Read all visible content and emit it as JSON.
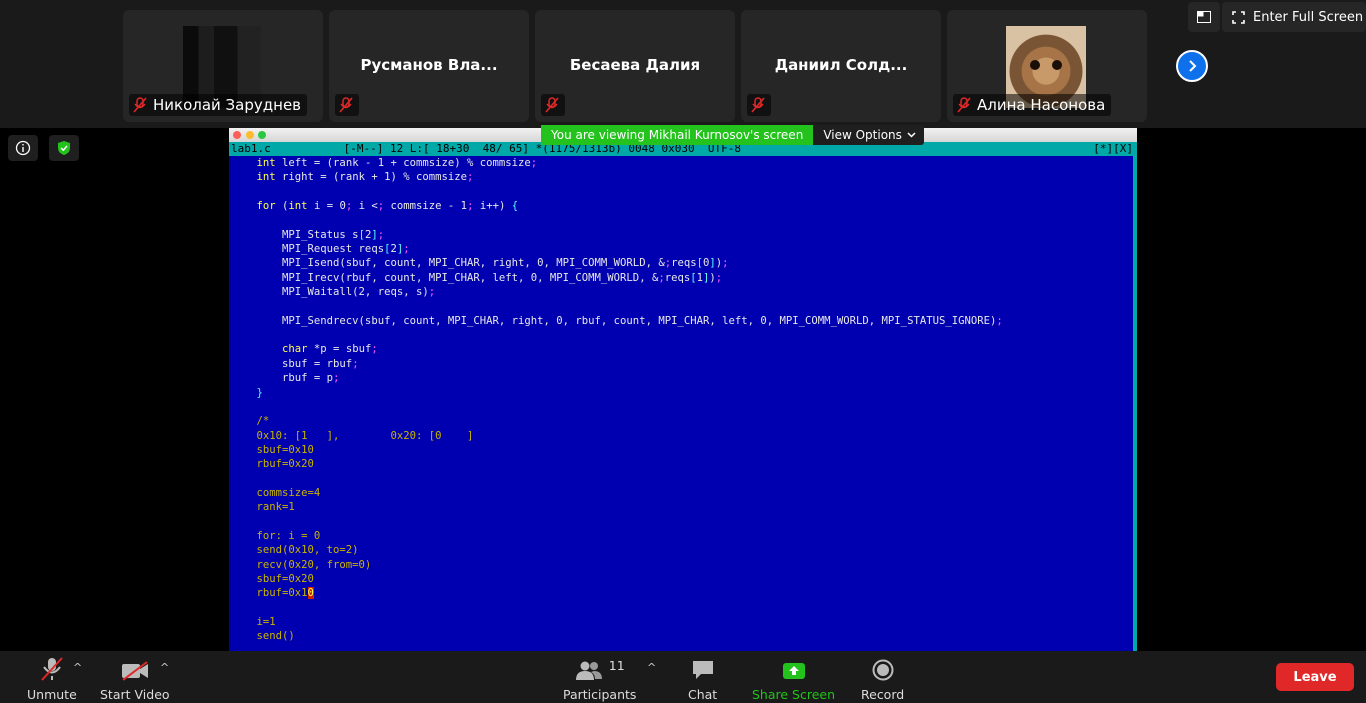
{
  "participants_strip": {
    "tiles": [
      {
        "name": "Николай Заруднев",
        "muted": true,
        "has_video": true
      },
      {
        "name": "Русманов Вла...",
        "muted": true,
        "has_video": false
      },
      {
        "name": "Бесаева Далия",
        "muted": true,
        "has_video": false
      },
      {
        "name": "Даниил Солд...",
        "muted": true,
        "has_video": false
      },
      {
        "name": "Алина Насонова",
        "muted": true,
        "has_video": true
      }
    ],
    "next_icon": "chevron-right-icon"
  },
  "top_controls": {
    "fullscreen_label": "Enter Full Screen"
  },
  "share_banner": {
    "text": "You are viewing Mikhail Kurnosov's screen",
    "options_label": "View Options"
  },
  "editor": {
    "status_left": "lab1.c           [-M--] 12 L:[ 18+30  48/ 65] *(1175/1313b) 0048 0x030  UTF-8",
    "status_right": "[*][X]",
    "lines": [
      "    int left = (rank - 1 + commsize) % commsize;",
      "    int right = (rank + 1) % commsize;",
      "",
      "    for (int i = 0; i < commsize - 1; i++) {",
      "",
      "        MPI_Status s[2];",
      "        MPI_Request reqs[2];",
      "        MPI_Isend(sbuf, count, MPI_CHAR, right, 0, MPI_COMM_WORLD, &reqs[0]);",
      "        MPI_Irecv(rbuf, count, MPI_CHAR, left, 0, MPI_COMM_WORLD, &reqs[1]);",
      "        MPI_Waitall(2, reqs, s);",
      "",
      "        MPI_Sendrecv(sbuf, count, MPI_CHAR, right, 0, rbuf, count, MPI_CHAR, left, 0, MPI_COMM_WORLD, MPI_STATUS_IGNORE);",
      "",
      "        char *p = sbuf;",
      "        sbuf = rbuf;",
      "        rbuf = p;",
      "    }",
      "",
      "    /*",
      "    0x10: [1   ],        0x20: [0    ]",
      "    sbuf=0x10",
      "    rbuf=0x20",
      "",
      "    commsize=4",
      "    rank=1",
      "",
      "    for: i = 0",
      "    send(0x10, to=2)",
      "    recv(0x20, from=0)",
      "    sbuf=0x20",
      "    rbuf=0x10",
      "",
      "    i=1",
      "    send()"
    ]
  },
  "toolbar": {
    "unmute_label": "Unmute",
    "video_label": "Start Video",
    "participants_label": "Participants",
    "participants_count": "11",
    "chat_label": "Chat",
    "share_label": "Share Screen",
    "record_label": "Record",
    "leave_label": "Leave"
  },
  "colors": {
    "share_green": "#23c21d",
    "leave_red": "#e02828",
    "editor_blue": "#0000b0",
    "status_cyan": "#00a8a8"
  }
}
